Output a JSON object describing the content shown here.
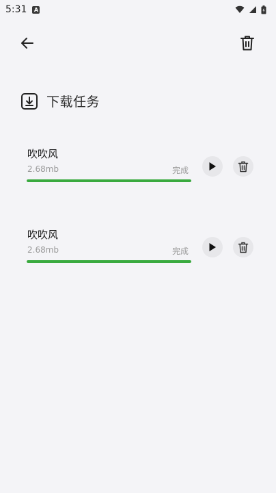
{
  "status_bar": {
    "time": "5:31",
    "notification_badge": "A"
  },
  "header": {
    "back_icon": "arrow-left-icon",
    "clear_icon": "trash-icon"
  },
  "section": {
    "title": "下载任务",
    "icon": "download-box-icon"
  },
  "tasks": [
    {
      "name": "吹吹风",
      "size": "2.68mb",
      "status": "完成",
      "progress": 1.0
    },
    {
      "name": "吹吹风",
      "size": "2.68mb",
      "status": "完成",
      "progress": 1.0
    }
  ],
  "colors": {
    "background": "#f4f4f7",
    "progress": "#3aaa3f",
    "button_bg": "#e7e7ea"
  }
}
